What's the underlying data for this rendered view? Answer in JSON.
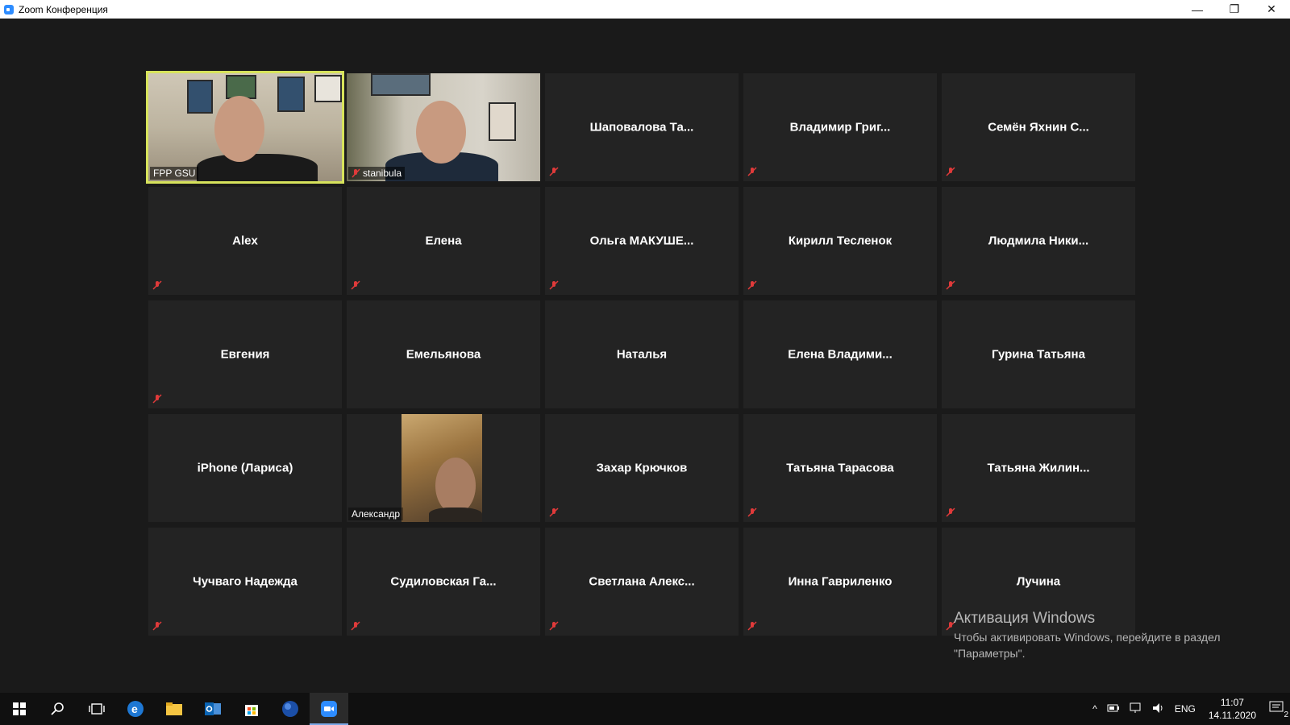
{
  "window": {
    "title": "Zoom Конференция",
    "controls": [
      "—",
      "❐",
      "✕"
    ]
  },
  "grid": {
    "tiles": [
      {
        "name": "FPP GSU",
        "video": true,
        "muted": false,
        "active": true
      },
      {
        "name": "stanibula",
        "video": true,
        "muted": true,
        "active": false
      },
      {
        "name": "Шаповалова  Та...",
        "video": false,
        "muted": true
      },
      {
        "name": "Владимир  Григ...",
        "video": false,
        "muted": true
      },
      {
        "name": "Семён Яхнин С...",
        "video": false,
        "muted": true
      },
      {
        "name": "Alex",
        "video": false,
        "muted": true
      },
      {
        "name": "Елена",
        "video": false,
        "muted": true
      },
      {
        "name": "Ольга  МАКУШЕ...",
        "video": false,
        "muted": true
      },
      {
        "name": "Кирилл Тесленок",
        "video": false,
        "muted": true
      },
      {
        "name": "Людмила  Ники...",
        "video": false,
        "muted": true
      },
      {
        "name": "Евгения",
        "video": false,
        "muted": true
      },
      {
        "name": "Емельянова",
        "video": false,
        "muted": false
      },
      {
        "name": "Наталья",
        "video": false,
        "muted": false
      },
      {
        "name": "Елена  Владими...",
        "video": false,
        "muted": false
      },
      {
        "name": "Гурина Татьяна",
        "video": false,
        "muted": false
      },
      {
        "name": "iPhone (Лариса)",
        "video": false,
        "muted": false
      },
      {
        "name": "Александр",
        "video": true,
        "muted": false
      },
      {
        "name": "Захар Крючков",
        "video": false,
        "muted": true
      },
      {
        "name": "Татьяна Тарасова",
        "video": false,
        "muted": true
      },
      {
        "name": "Татьяна  Жилин...",
        "video": false,
        "muted": true
      },
      {
        "name": "Чучваго Надежда",
        "video": false,
        "muted": true
      },
      {
        "name": "Судиловская  Га...",
        "video": false,
        "muted": true
      },
      {
        "name": "Светлана  Алекс...",
        "video": false,
        "muted": true
      },
      {
        "name": "Инна Гавриленко",
        "video": false,
        "muted": true
      },
      {
        "name": "Лучина",
        "video": false,
        "muted": true
      }
    ]
  },
  "activation": {
    "title": "Активация Windows",
    "text": "Чтобы активировать Windows, перейдите в раздел \"Параметры\"."
  },
  "taskbar": {
    "apps": [
      "windows-start",
      "search",
      "task-view",
      "edge",
      "file-explorer",
      "outlook",
      "store",
      "browser",
      "zoom"
    ],
    "language": "ENG",
    "time": "11:07",
    "date": "14.11.2020",
    "notifications": "2"
  },
  "colors": {
    "active_speaker": "#d7e35b",
    "muted_icon": "#e03a3a",
    "tile_bg": "#232323",
    "zoom_blue": "#2d8cff"
  }
}
